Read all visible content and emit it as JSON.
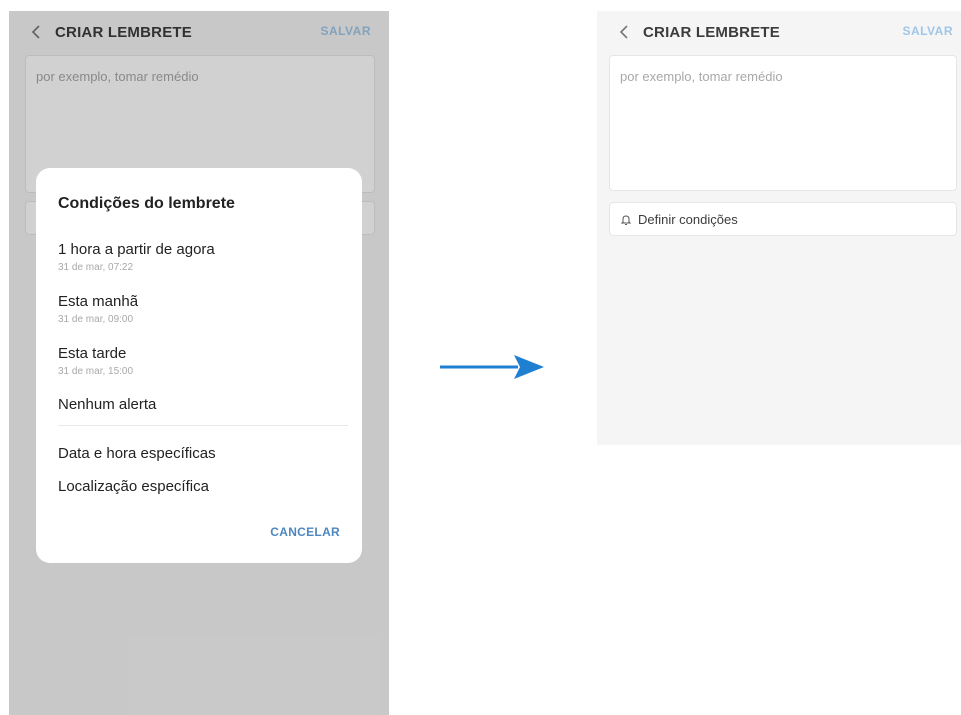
{
  "left_screen": {
    "header": {
      "title": "CRIAR LEMBRETE",
      "save_label": "SALVAR"
    },
    "note": {
      "placeholder": "por exemplo, tomar remédio"
    },
    "dialog": {
      "title": "Condições do lembrete",
      "options": [
        {
          "label": "1 hora a partir de agora",
          "sub": "31 de mar, 07:22"
        },
        {
          "label": "Esta manhã",
          "sub": "31 de mar, 09:00"
        },
        {
          "label": "Esta tarde",
          "sub": "31 de mar, 15:00"
        },
        {
          "label": "Nenhum alerta"
        }
      ],
      "extra_options": [
        {
          "label": "Data e hora específicas"
        },
        {
          "label": "Localização específica"
        }
      ],
      "cancel_label": "CANCELAR"
    }
  },
  "right_screen": {
    "header": {
      "title": "CRIAR LEMBRETE",
      "save_label": "SALVAR"
    },
    "note": {
      "placeholder": "por exemplo, tomar remédio"
    },
    "conditions_button": {
      "label": "Definir condições",
      "icon": "bell-icon"
    }
  },
  "colors": {
    "accent": "#4c87c0",
    "save_disabled": "#9fc6e8",
    "arrow": "#1f7fd1"
  }
}
